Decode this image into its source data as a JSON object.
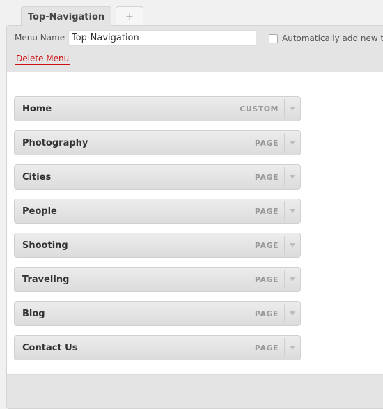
{
  "tabs": [
    {
      "label": "Top-Navigation",
      "active": true
    },
    {
      "label": "+",
      "active": false
    }
  ],
  "header": {
    "menu_name_label": "Menu Name",
    "menu_name_value": "Top-Navigation",
    "auto_add_label": "Automatically add new top-level pages",
    "delete_label": "Delete Menu"
  },
  "menu_items": [
    {
      "title": "Home",
      "type": "CUSTOM"
    },
    {
      "title": "Photography",
      "type": "PAGE"
    },
    {
      "title": "Cities",
      "type": "PAGE"
    },
    {
      "title": "People",
      "type": "PAGE"
    },
    {
      "title": "Shooting",
      "type": "PAGE"
    },
    {
      "title": "Traveling",
      "type": "PAGE"
    },
    {
      "title": "Blog",
      "type": "PAGE"
    },
    {
      "title": "Contact Us",
      "type": "PAGE"
    }
  ],
  "icons": {
    "item_toggle": "chevron-down-icon",
    "checkbox": "checkbox-icon"
  },
  "colors": {
    "delete_link": "#cc1111",
    "header_bg": "#e4e4e4",
    "item_bg": "#e2e2e2"
  }
}
